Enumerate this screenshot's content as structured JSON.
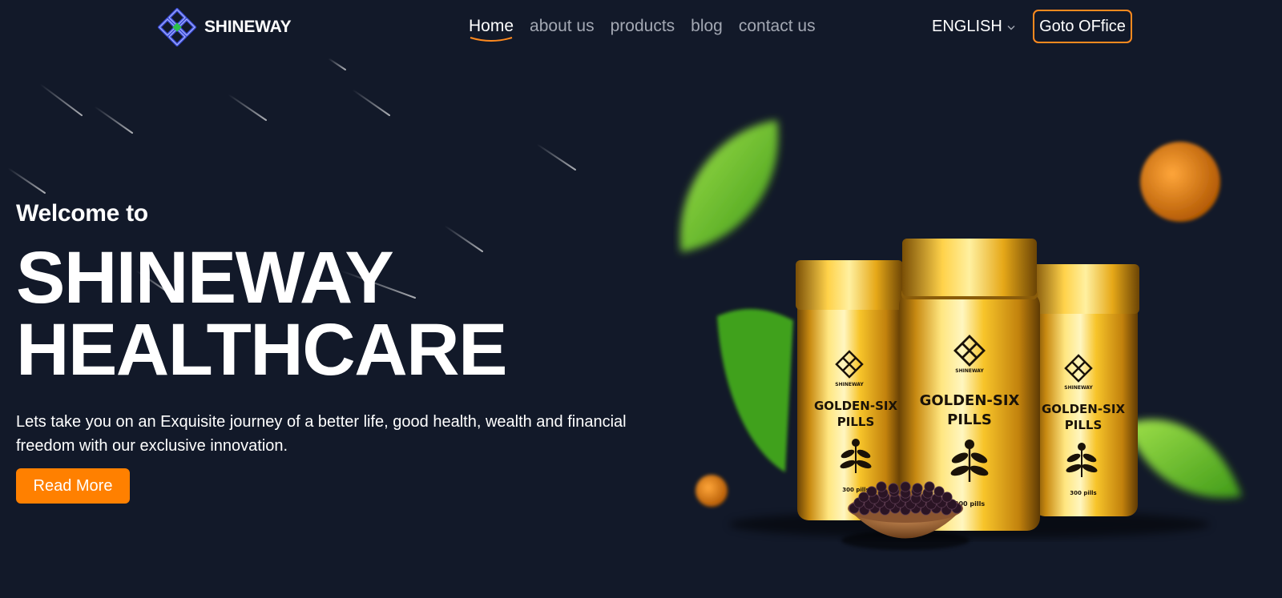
{
  "header": {
    "brand_name": "SHINEWAY",
    "nav": [
      {
        "label": "Home",
        "active": true
      },
      {
        "label": "about us",
        "active": false
      },
      {
        "label": "products",
        "active": false
      },
      {
        "label": "blog",
        "active": false
      },
      {
        "label": "contact us",
        "active": false
      }
    ],
    "language": "ENGLISH",
    "office_button": "Goto OFfice"
  },
  "hero": {
    "welcome": "Welcome to",
    "title_line1": "SHINEWAY",
    "title_line2": "HEALTHCARE",
    "description": "Lets take you on an Exquisite journey of a better life, good health, wealth and financial freedom with our exclusive innovation.",
    "read_more": "Read More"
  },
  "product": {
    "brand_mark": "SHINEWAY",
    "label_line1": "GOLDEN-SIX",
    "label_line2": "PILLS",
    "count": "300 pills"
  },
  "colors": {
    "background": "#121929",
    "accent": "#ff8000",
    "nav_inactive": "#a3a8b3"
  }
}
